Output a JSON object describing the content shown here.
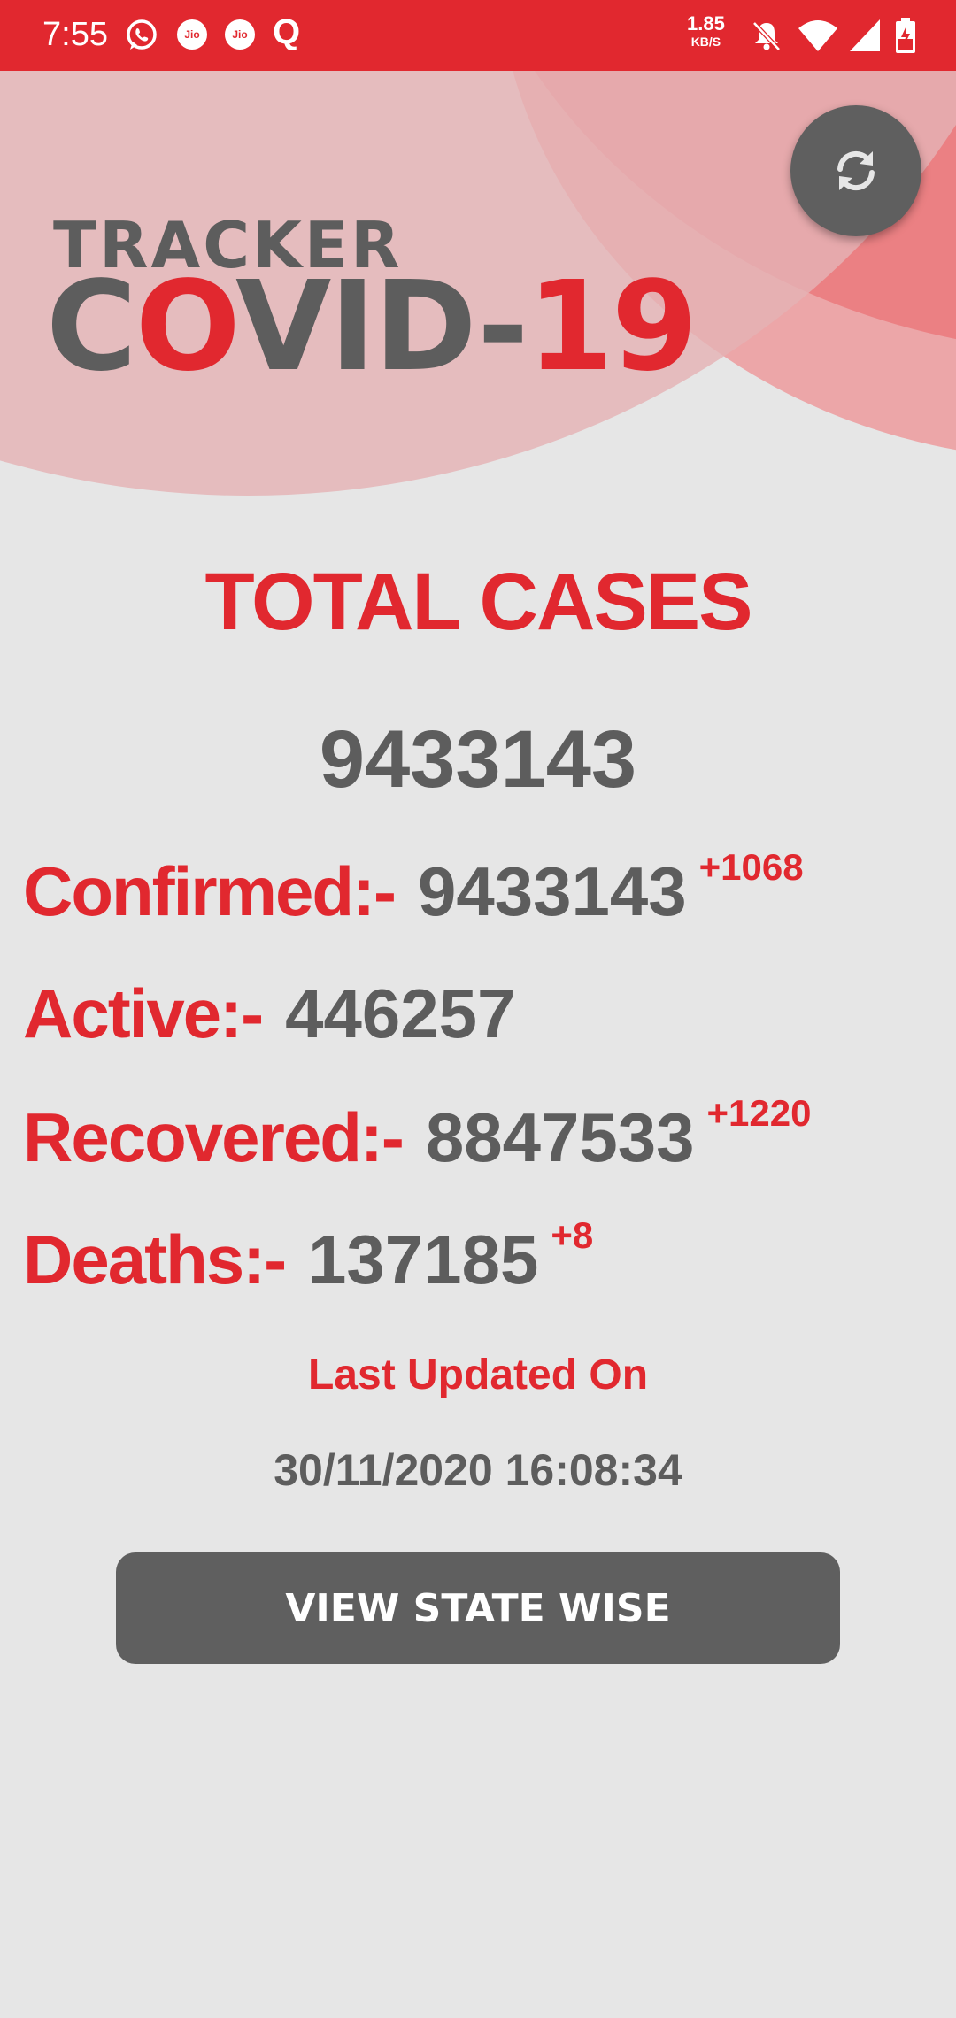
{
  "status_bar": {
    "time": "7:55",
    "jio_label": "Jio",
    "q_label": "Q",
    "speed_value": "1.85",
    "speed_unit": "KB/S",
    "icons": [
      "whatsapp-icon",
      "jio-icon",
      "jio-icon",
      "q-app-icon",
      "bell-muted-icon",
      "wifi-icon",
      "signal-icon",
      "battery-charging-icon"
    ]
  },
  "header": {
    "logo_top": "TRACKER",
    "logo_covid_a": "C",
    "logo_covid_b": "O",
    "logo_covid_c": "VID-",
    "logo_covid_d": "19",
    "refresh_icon": "refresh-icon"
  },
  "summary": {
    "title": "TOTAL CASES",
    "total": "9433143"
  },
  "stats": {
    "confirmed": {
      "label": "Confirmed:-",
      "value": "9433143",
      "delta": "+1068"
    },
    "active": {
      "label": "Active:-",
      "value": "446257"
    },
    "recovered": {
      "label": "Recovered:-",
      "value": "8847533",
      "delta": "+1220"
    },
    "deaths": {
      "label": "Deaths:-",
      "value": "137185",
      "delta": "+8"
    }
  },
  "updated": {
    "label": "Last Updated On",
    "value": "30/11/2020 16:08:34"
  },
  "actions": {
    "state_wise_label": "VIEW STATE WISE"
  },
  "colors": {
    "accent_red": "#e1282f",
    "text_gray": "#5d5d5d",
    "background": "#e6e6e6",
    "button_gray": "#5f5f5f"
  }
}
